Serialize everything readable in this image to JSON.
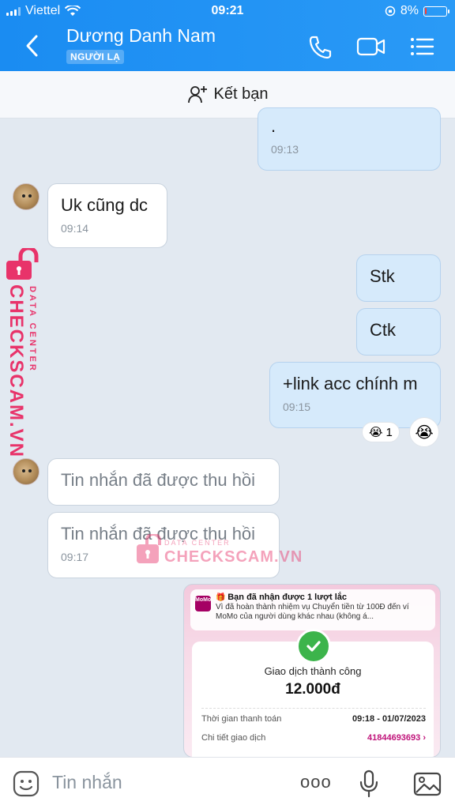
{
  "status_bar": {
    "carrier": "Viettel",
    "time": "09:21",
    "battery": "8%",
    "battery_level": 0.08
  },
  "header": {
    "contact_name": "Dương Danh Nam",
    "badge": "NGƯỜI LẠ"
  },
  "friend_bar": {
    "label": "Kết bạn"
  },
  "messages": [
    {
      "from": "me",
      "text": ".",
      "time": "09:13"
    },
    {
      "from": "them",
      "text": "Uk cũng dc",
      "time": "09:14"
    },
    {
      "from": "me",
      "text": "Stk"
    },
    {
      "from": "me",
      "text": "Ctk"
    },
    {
      "from": "me",
      "text": "+link acc chính m",
      "time": "09:15",
      "reaction": {
        "emoji": "😭",
        "count": "1"
      }
    },
    {
      "from": "them",
      "text": "Tin nhắn đã được thu hồi"
    },
    {
      "from": "them",
      "text": "Tin nhắn đã được thu hồi",
      "time": "09:17"
    }
  ],
  "receipt": {
    "notif_icon": "MoMo",
    "notif_title": "Bạn đã nhận được 1 lượt lắc",
    "notif_body": "Vì đã hoàn thành nhiệm vụ Chuyển tiền từ 100Đ đến ví MoMo của người dùng khác nhau (không á...",
    "title": "Giao dịch thành công",
    "amount": "12.000đ",
    "rows": [
      {
        "label": "Thời gian thanh toán",
        "value": "09:18 - 01/07/2023"
      },
      {
        "label": "Chi tiết giao dịch",
        "value": "41844693693 ›"
      }
    ]
  },
  "watermark": {
    "brand": "CHECKSCAM.VN",
    "sub": "DATA CENTER"
  },
  "composer": {
    "placeholder": "Tin nhắn",
    "more": "ooo"
  },
  "colors": {
    "header": "#1a8cf2",
    "my_bubble": "#d6eafb",
    "watermark": "#e8336a"
  }
}
